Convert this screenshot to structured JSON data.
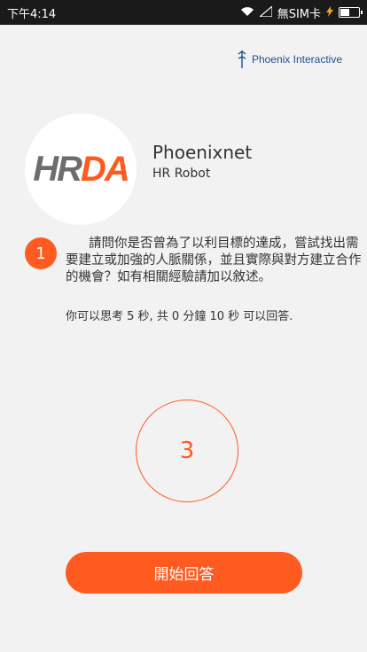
{
  "status_bar": {
    "time": "下午4:14",
    "carrier": "無SIM卡",
    "icons": [
      "wifi-icon",
      "signal-icon",
      "charging-icon",
      "battery-icon"
    ]
  },
  "brand": {
    "name": "Phoenix Interactive",
    "icon": "phoenix-logo-icon",
    "color": "#1f4f8f"
  },
  "profile": {
    "logo_hr": "HR",
    "logo_da": "DA",
    "name": "Phoenixnet",
    "role": "HR Robot"
  },
  "question": {
    "number": "1",
    "text": "請問你是否曾為了以利目標的達成，嘗試找出需要建立或加強的人脈關係，並且實際與對方建立合作的機會？如有相關經驗請加以敘述。",
    "hint": "你可以思考 5 秒, 共 0 分鐘 10 秒 可以回答."
  },
  "countdown": {
    "value": "3"
  },
  "actions": {
    "start_label": "開始回答"
  },
  "colors": {
    "accent": "#ff5a1f",
    "background": "#f2f2f2",
    "status_bar": "#1a1a1a"
  }
}
